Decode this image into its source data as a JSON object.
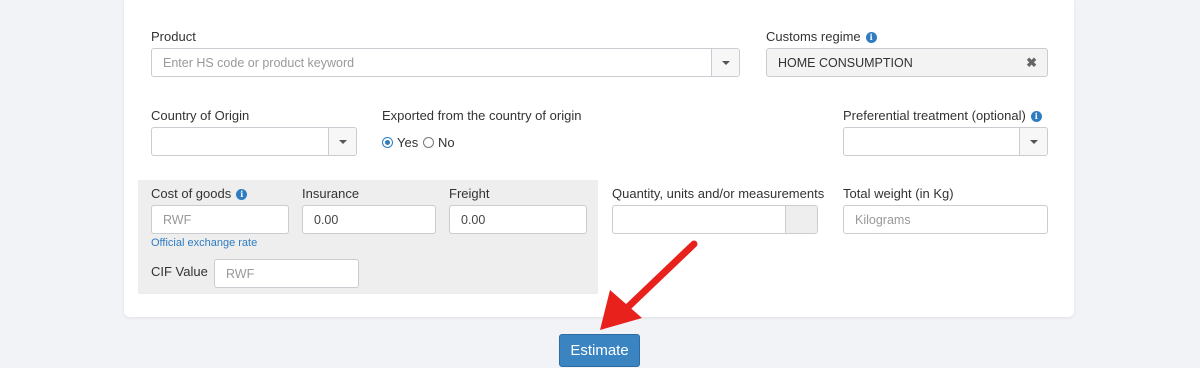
{
  "form": {
    "product": {
      "label": "Product",
      "placeholder": "Enter HS code or product keyword"
    },
    "customs_regime": {
      "label": "Customs regime",
      "value": "HOME CONSUMPTION"
    },
    "country_of_origin": {
      "label": "Country of Origin",
      "value": ""
    },
    "exported_from_origin": {
      "label": "Exported from the country of origin",
      "options": [
        "Yes",
        "No"
      ],
      "selected": "Yes"
    },
    "preferential_treatment": {
      "label": "Preferential treatment (optional)",
      "value": ""
    },
    "cost_of_goods": {
      "label": "Cost of goods",
      "placeholder": "RWF",
      "link": "Official exchange rate"
    },
    "insurance": {
      "label": "Insurance",
      "value": "0.00"
    },
    "freight": {
      "label": "Freight",
      "value": "0.00"
    },
    "quantity": {
      "label": "Quantity, units and/or measurements",
      "value": ""
    },
    "total_weight": {
      "label": "Total weight (in Kg)",
      "placeholder": "Kilograms"
    },
    "cif_value": {
      "label": "CIF Value",
      "placeholder": "RWF"
    }
  },
  "actions": {
    "estimate_label": "Estimate"
  },
  "colors": {
    "accent": "#3a84c1",
    "arrow": "#e8211d",
    "info": "#2f7dc0"
  },
  "icons": [
    "info-icon",
    "chevron-down-icon",
    "clear-icon",
    "arrow-pointer"
  ]
}
